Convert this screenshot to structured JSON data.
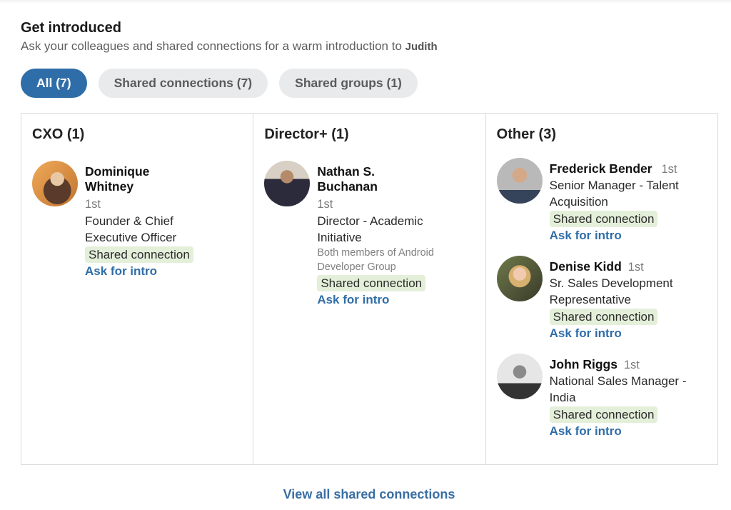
{
  "header": {
    "title": "Get introduced",
    "subtitle": "Ask your colleagues and shared connections for a warm introduction to",
    "target_name": "Judith"
  },
  "filters": [
    {
      "label": "All (7)",
      "active": true
    },
    {
      "label": "Shared connections (7)",
      "active": false
    },
    {
      "label": "Shared groups (1)",
      "active": false
    }
  ],
  "columns": [
    {
      "title": "CXO (1)",
      "people": [
        {
          "name": "Dominique Whitney",
          "degree": "1st",
          "headline": "Founder & Chief Executive Officer",
          "badge": "Shared connection",
          "action": "Ask for intro",
          "avatar": "woman-long-hair-photo"
        }
      ]
    },
    {
      "title": "Director+ (1)",
      "people": [
        {
          "name": "Nathan S. Buchanan",
          "degree": "1st",
          "headline": "Director - Academic Initiative",
          "note": "Both members of Android Developer Group",
          "badge": "Shared connection",
          "action": "Ask for intro",
          "avatar": "man-plaid-shirt-photo"
        }
      ]
    },
    {
      "title": "Other (3)",
      "people": [
        {
          "name": "Frederick Bender",
          "degree": "1st",
          "headline": "Senior Manager - Talent Acquisition",
          "badge": "Shared connection",
          "action": "Ask for intro",
          "avatar": "man-portrait-photo"
        },
        {
          "name": "Denise Kidd",
          "degree": "1st",
          "headline": "Sr. Sales Development Representative",
          "badge": "Shared connection",
          "action": "Ask for intro",
          "avatar": "woman-blonde-photo"
        },
        {
          "name": "John Riggs",
          "degree": "1st",
          "headline": "National Sales Manager - India",
          "badge": "Shared connection",
          "action": "Ask for intro",
          "avatar": "man-bw-photo"
        }
      ]
    }
  ],
  "footer": {
    "link": "View all shared connections"
  },
  "colors": {
    "accent": "#2f6da8",
    "badge_bg": "#e4efda",
    "pill_bg": "#e9eaec"
  }
}
